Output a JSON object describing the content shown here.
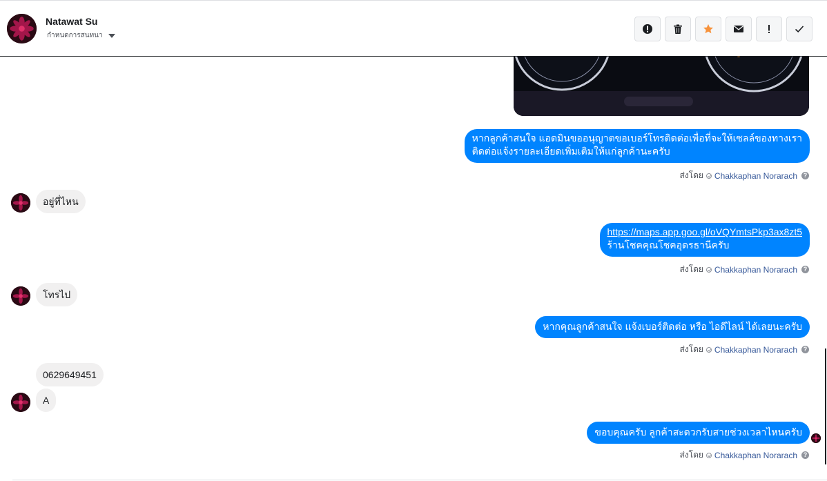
{
  "header": {
    "contact_name": "Natawat Su",
    "manage_label": "กำหนดการสนทนา"
  },
  "toolbar": {
    "buttons": [
      {
        "icon": "alert-circle-icon"
      },
      {
        "icon": "trash-icon"
      },
      {
        "icon": "star-icon"
      },
      {
        "icon": "envelope-icon"
      },
      {
        "icon": "exclamation-icon"
      },
      {
        "icon": "checkmark-icon"
      }
    ],
    "star_color": "#f7923b"
  },
  "colors": {
    "outgoing_bubble": "#0084ff",
    "incoming_bubble": "#f1f0f0",
    "agent_link": "#365899"
  },
  "messages": {
    "m1": {
      "line1": "หากลูกค้าสนใจ แอดมินขออนุญาตขอเบอร์โทรติดต่อเพื่อที่จะให้เซลล์ของทางเรา",
      "line2": "ติดต่อแจ้งรายละเอียดเพิ่มเติมให้แก่ลูกค้านะครับ"
    },
    "m2": "อยู่ที่ไหน",
    "m3": {
      "link": "https://maps.app.goo.gl/oVQYmtsPkp3ax8zt5",
      "line2": "ร้านโชคคุณโชคอุดรธานีครับ"
    },
    "m4": "โทรไป",
    "m5": "หากคุณลูกค้าสนใจ แจ้งเบอร์ติดต่อ หรือ ไอดีไลน์ ได้เลยนะครับ",
    "m6": "0629649451",
    "m7": "A",
    "m8": "ขอบคุณครับ ลูกค้าสะดวกรับสายช่วงเวลาไหนครับ"
  },
  "sent_by": {
    "prefix": "ส่งโดย",
    "agent": "Chakkaphan Norarach",
    "help": "?"
  }
}
